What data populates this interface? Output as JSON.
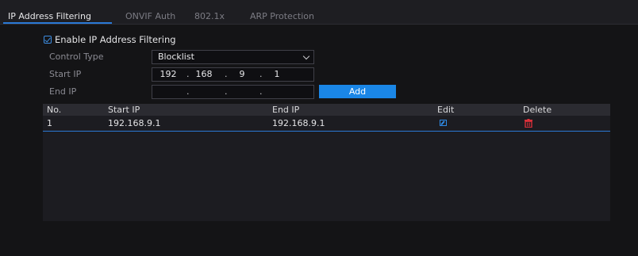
{
  "tabs": [
    {
      "label": "IP Address Filtering",
      "active": true
    },
    {
      "label": "ONVIF Auth",
      "active": false
    },
    {
      "label": "802.1x",
      "active": false
    },
    {
      "label": "ARP Protection",
      "active": false
    }
  ],
  "enable_checkbox": {
    "label": "Enable IP Address Filtering",
    "checked": true
  },
  "form": {
    "control_type_label": "Control Type",
    "control_type_value": "Blocklist",
    "start_ip_label": "Start IP",
    "start_ip": [
      "192",
      "168",
      "9",
      "1"
    ],
    "end_ip_label": "End IP",
    "end_ip": [
      "",
      "",
      "",
      ""
    ],
    "add_label": "Add"
  },
  "table": {
    "headers": [
      "No.",
      "Start IP",
      "End IP",
      "Edit",
      "Delete"
    ],
    "rows": [
      {
        "no": "1",
        "start_ip": "192.168.9.1",
        "end_ip": "192.168.9.1"
      }
    ]
  },
  "colors": {
    "accent": "#2a79d6",
    "button": "#1a86e6",
    "delete": "#e0303a"
  },
  "icons": {
    "edit": "edit-icon",
    "delete": "trash-icon",
    "checkbox": "checkbox-icon",
    "dropdown": "chevron-down-icon"
  }
}
